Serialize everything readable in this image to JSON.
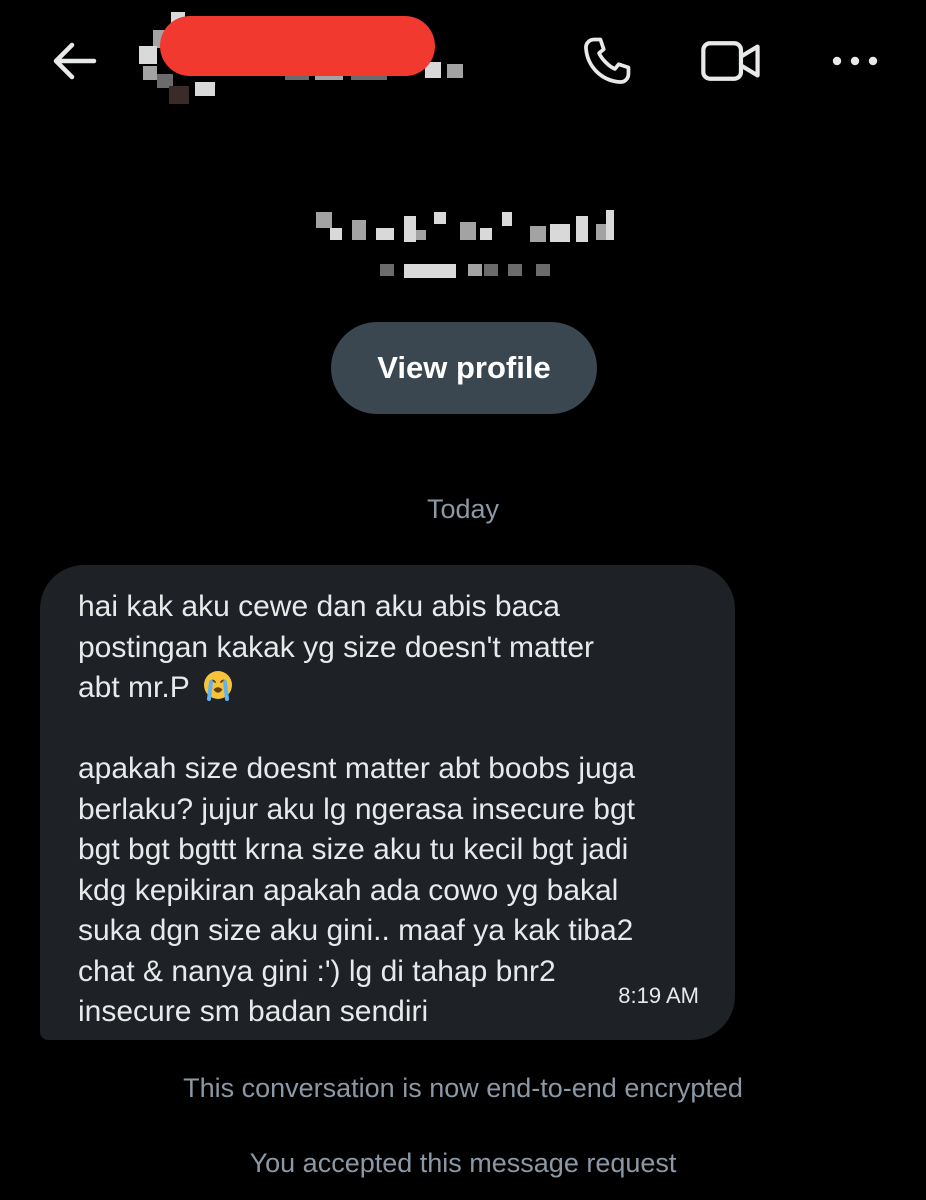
{
  "header": {
    "back_icon": "arrow-left-icon",
    "title": "",
    "call_icon": "phone-icon",
    "video_icon": "video-camera-icon",
    "more_icon": "more-horizontal-icon"
  },
  "profile": {
    "view_profile_label": "View profile"
  },
  "conversation": {
    "date_label": "Today",
    "messages": [
      {
        "direction": "incoming",
        "text_part1": "hai kak aku cewe dan aku abis baca\npostingan kakak yg size doesn't matter\nabt mr.P ",
        "emoji": "loudly-crying-face-icon",
        "text_part2": "\n\napakah size doesnt matter abt boobs juga\nberlaku? jujur aku lg ngerasa insecure bgt\nbgt bgt bgttt krna size aku tu kecil bgt jadi\nkdg kepikiran apakah ada cowo yg bakal\nsuka dgn size aku gini.. maaf ya kak tiba2\nchat & nanya gini :') lg di tahap bnr2\ninsecure sm badan sendiri",
        "time": "8:19 AM"
      }
    ],
    "encrypted_note": "This conversation is now end-to-end encrypted",
    "accepted_note": "You accepted this message request"
  },
  "colors": {
    "background": "#000000",
    "bubble": "#1e2125",
    "button": "#3a4751",
    "muted_text": "#8b98a5",
    "primary_text": "#e7e9ea",
    "redaction": "#f2392f"
  }
}
